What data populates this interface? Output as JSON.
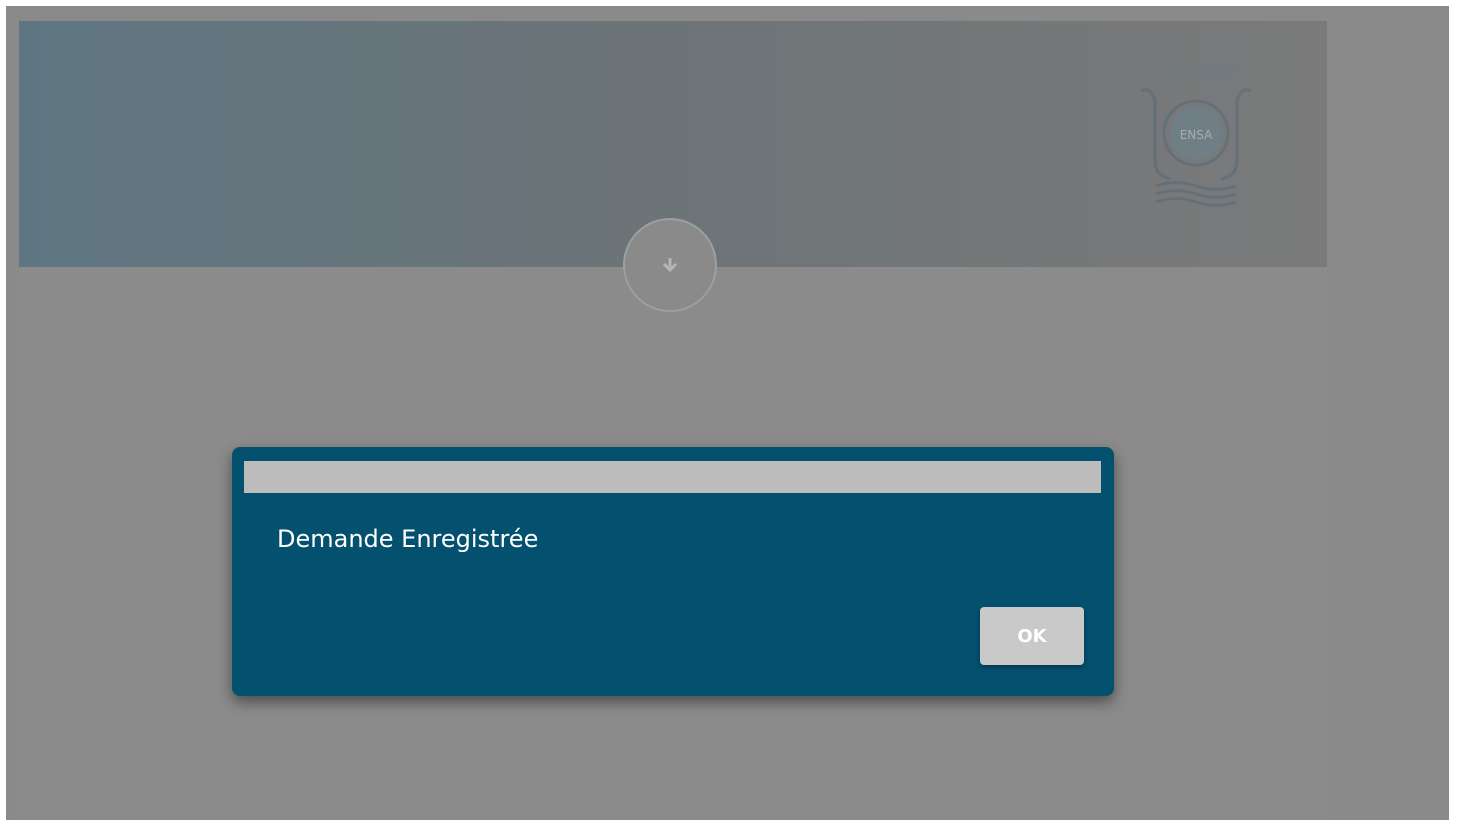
{
  "header": {
    "logo_icon": "university-logo-icon",
    "scroll_icon": "arrow-down-icon"
  },
  "dialog": {
    "message": "Demande Enregistrée",
    "ok_label": "OK"
  },
  "colors": {
    "dialog_background": "#04506f",
    "overlay": "#8a8a8a",
    "button": "#c9c9c9"
  }
}
